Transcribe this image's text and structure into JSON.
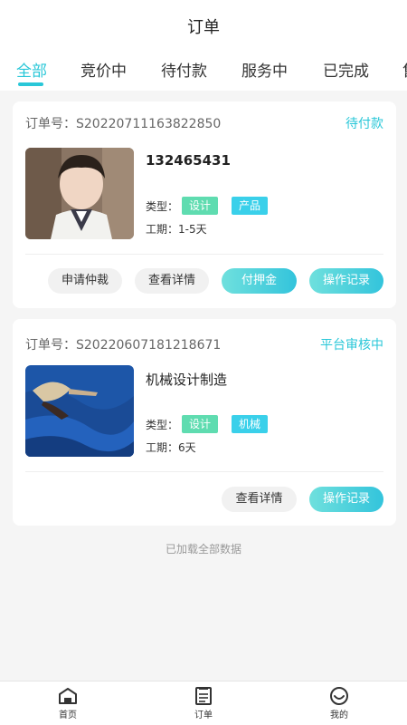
{
  "header": {
    "title": "订单"
  },
  "tabs": [
    "全部",
    "竞价中",
    "待付款",
    "服务中",
    "已完成",
    "售"
  ],
  "colors": {
    "accent": "#29c7d8",
    "tag_green": "#5fdcb0",
    "tag_cyan": "#3ad0ea"
  },
  "orders": [
    {
      "order_label": "订单号：S20220711163822850",
      "status": "待付款",
      "name": "132465431",
      "type_label": "类型：",
      "tags": [
        "设计",
        "产品"
      ],
      "period": "工期：1-5天",
      "actions": [
        "申请仲裁",
        "查看详情",
        "付押金",
        "操作记录"
      ]
    },
    {
      "order_label": "订单号：S20220607181218671",
      "status": "平台审核中",
      "name": "机械设计制造",
      "type_label": "类型：",
      "tags": [
        "设计",
        "机械"
      ],
      "period": "工期：6天",
      "actions": [
        "查看详情",
        "操作记录"
      ]
    }
  ],
  "footer_note": "已加载全部数据",
  "nav": [
    {
      "label": "首页",
      "icon": "home-icon"
    },
    {
      "label": "订单",
      "icon": "order-icon"
    },
    {
      "label": "我的",
      "icon": "smile-icon"
    }
  ]
}
